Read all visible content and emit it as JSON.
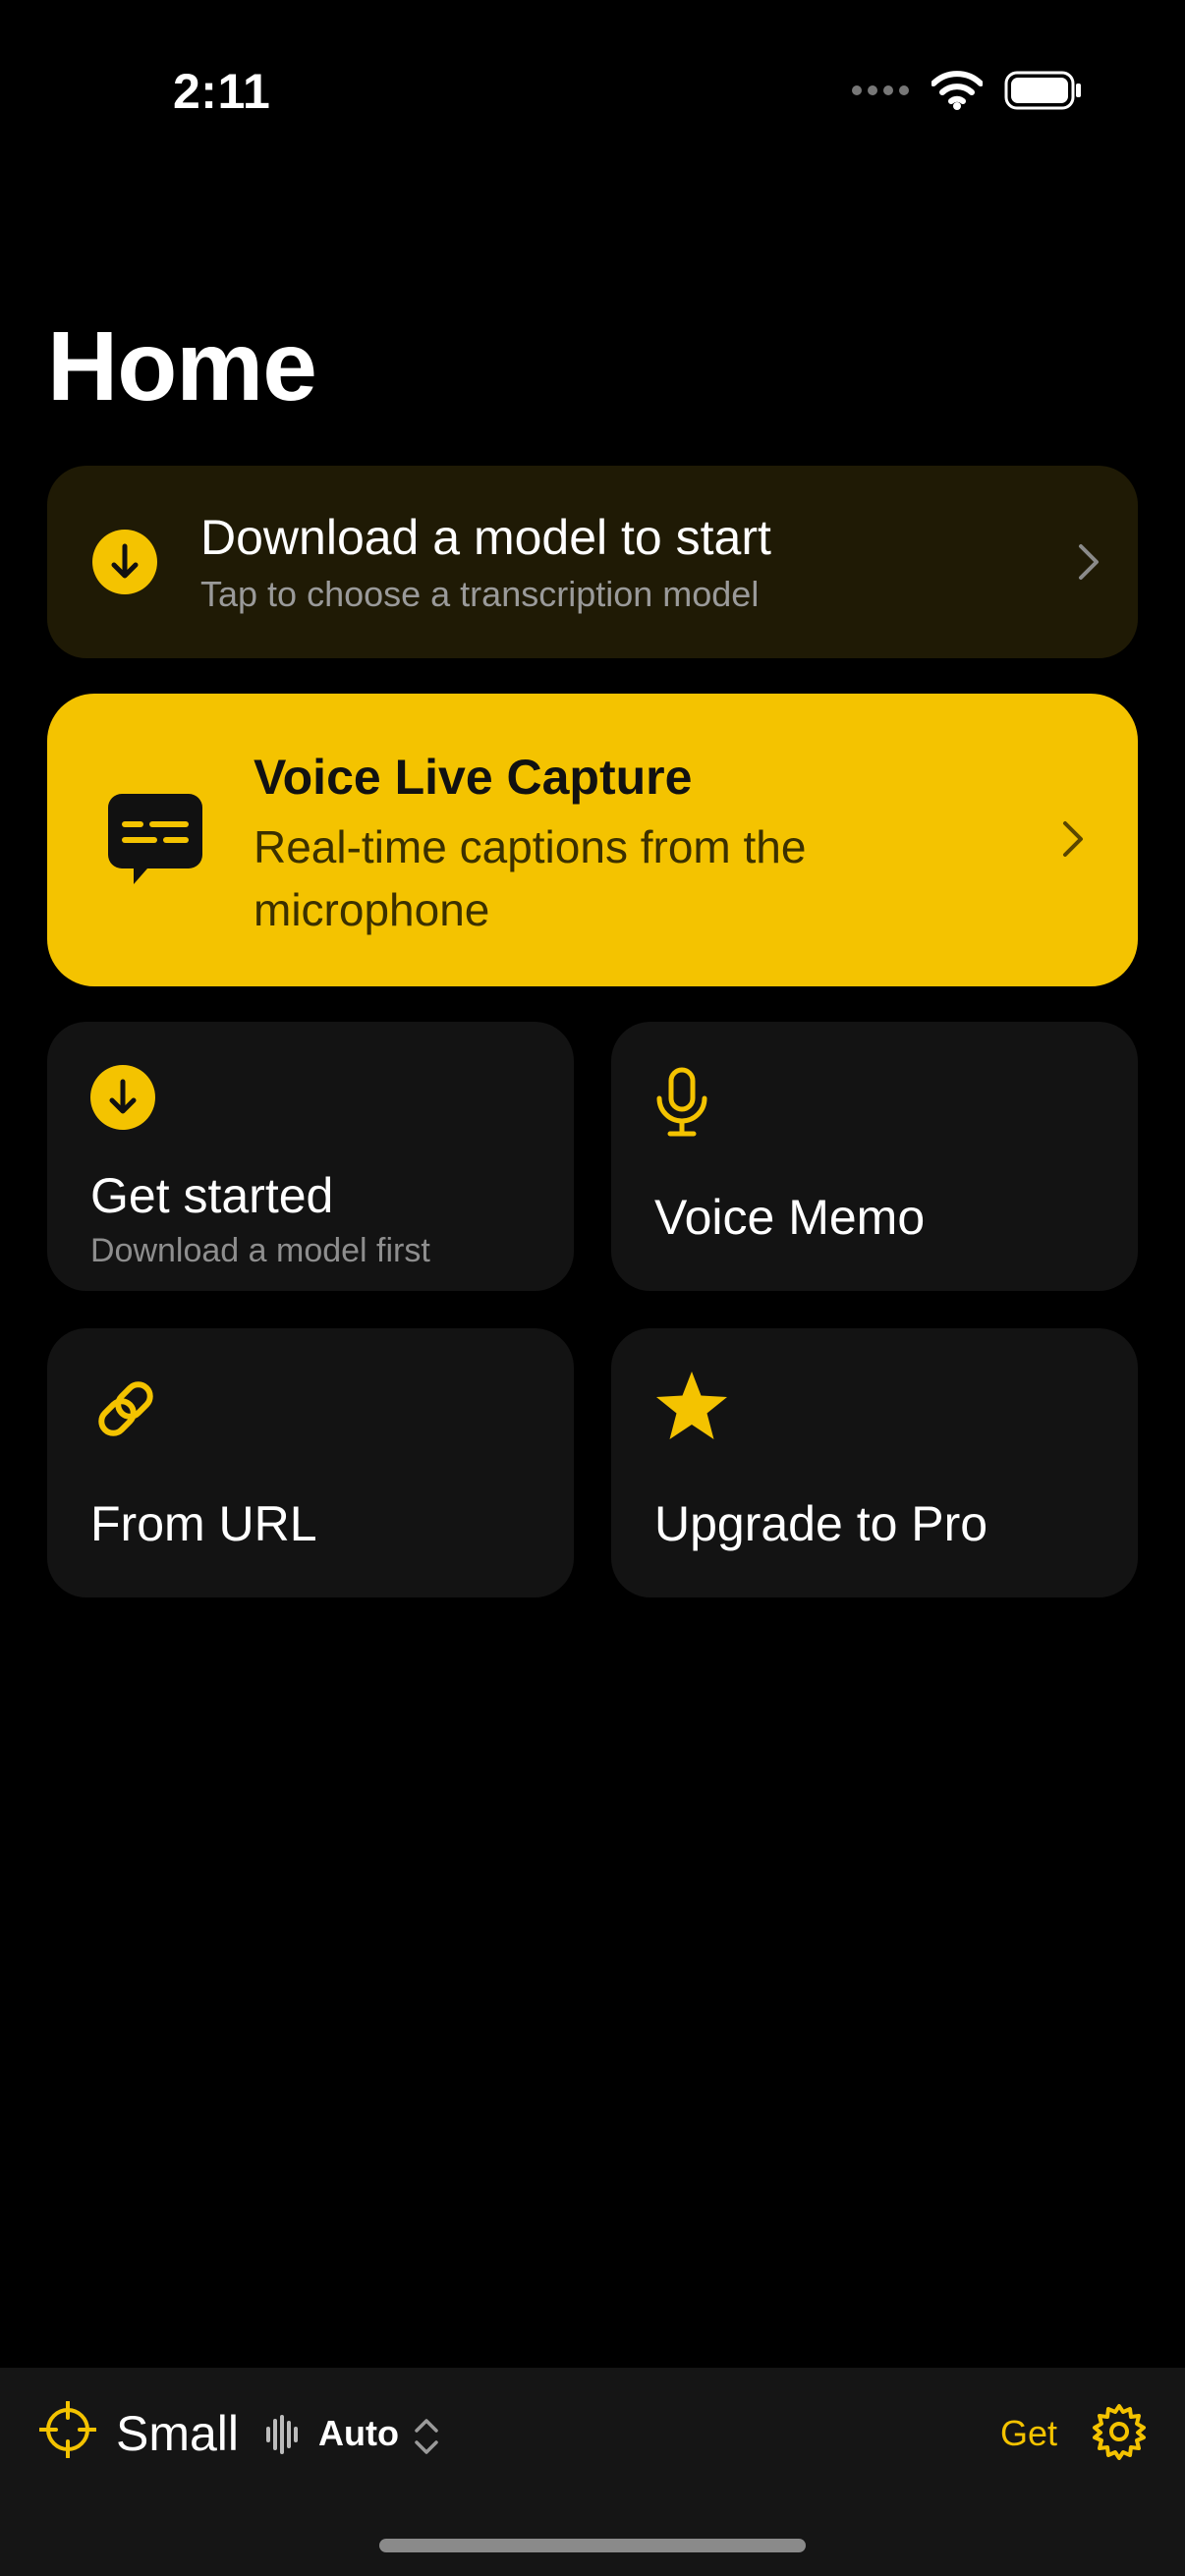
{
  "status_bar": {
    "time": "2:11"
  },
  "header": {
    "title": "Home"
  },
  "banner": {
    "title": "Download a model to start",
    "subtitle": "Tap to choose a transcription model"
  },
  "live_capture": {
    "title": "Voice Live Capture",
    "subtitle": "Real-time captions from the microphone"
  },
  "tiles": [
    {
      "title": "Get started",
      "subtitle": "Download a model first",
      "icon": "download-circle-icon"
    },
    {
      "title": "Voice Memo",
      "icon": "microphone-icon"
    },
    {
      "title": "From URL",
      "icon": "link-icon"
    },
    {
      "title": "Upgrade to Pro",
      "icon": "star-icon"
    }
  ],
  "bottom_bar": {
    "model": "Small",
    "language_mode": "Auto",
    "get_label": "Get"
  },
  "colors": {
    "accent": "#f4c300",
    "background": "#000000",
    "card": "#131313",
    "banner": "#1f1a05"
  }
}
